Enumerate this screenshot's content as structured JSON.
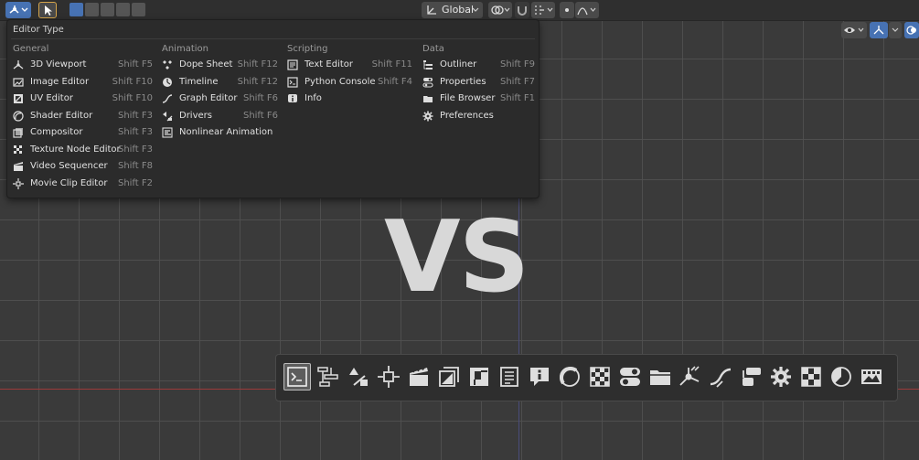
{
  "header": {
    "orientation_label": "Global"
  },
  "menu": {
    "title": "Editor Type",
    "columns": [
      {
        "heading": "General",
        "items": [
          {
            "label": "3D Viewport",
            "shortcut": "Shift F5",
            "icon": "viewport-3d-icon"
          },
          {
            "label": "Image Editor",
            "shortcut": "Shift F10",
            "icon": "image-editor-icon"
          },
          {
            "label": "UV Editor",
            "shortcut": "Shift F10",
            "icon": "uv-editor-icon"
          },
          {
            "label": "Shader Editor",
            "shortcut": "Shift F3",
            "icon": "shader-editor-icon"
          },
          {
            "label": "Compositor",
            "shortcut": "Shift F3",
            "icon": "compositor-icon"
          },
          {
            "label": "Texture Node Editor",
            "shortcut": "Shift F3",
            "icon": "texture-node-icon"
          },
          {
            "label": "Video Sequencer",
            "shortcut": "Shift F8",
            "icon": "video-sequencer-icon"
          },
          {
            "label": "Movie Clip Editor",
            "shortcut": "Shift F2",
            "icon": "movie-clip-icon"
          }
        ]
      },
      {
        "heading": "Animation",
        "items": [
          {
            "label": "Dope Sheet",
            "shortcut": "Shift F12",
            "icon": "dope-sheet-icon"
          },
          {
            "label": "Timeline",
            "shortcut": "Shift F12",
            "icon": "timeline-icon"
          },
          {
            "label": "Graph Editor",
            "shortcut": "Shift F6",
            "icon": "graph-editor-icon"
          },
          {
            "label": "Drivers",
            "shortcut": "Shift F6",
            "icon": "drivers-icon"
          },
          {
            "label": "Nonlinear Animation",
            "shortcut": "",
            "icon": "nla-icon"
          }
        ]
      },
      {
        "heading": "Scripting",
        "items": [
          {
            "label": "Text Editor",
            "shortcut": "Shift F11",
            "icon": "text-editor-icon"
          },
          {
            "label": "Python Console",
            "shortcut": "Shift F4",
            "icon": "python-console-icon"
          },
          {
            "label": "Info",
            "shortcut": "",
            "icon": "info-icon"
          }
        ]
      },
      {
        "heading": "Data",
        "items": [
          {
            "label": "Outliner",
            "shortcut": "Shift F9",
            "icon": "outliner-icon"
          },
          {
            "label": "Properties",
            "shortcut": "Shift F7",
            "icon": "properties-icon"
          },
          {
            "label": "File Browser",
            "shortcut": "Shift F1",
            "icon": "file-browser-icon"
          },
          {
            "label": "Preferences",
            "shortcut": "",
            "icon": "preferences-icon"
          }
        ]
      }
    ]
  },
  "overlay": {
    "vs_text": "VS"
  },
  "icon_bar": [
    "python-console-icon",
    "nla-icon",
    "drivers-icon",
    "movie-clip-icon",
    "video-sequencer-icon",
    "compositor-icon",
    "uv-editor-icon",
    "text-editor-icon",
    "info-icon",
    "shader-editor-icon",
    "texture-node-icon",
    "properties-icon",
    "file-browser-icon",
    "viewport-3d-icon",
    "graph-editor-icon",
    "outliner-icon",
    "preferences-icon",
    "texture-checker-icon",
    "timeline-icon",
    "image-editor-icon"
  ],
  "colors": {
    "accent_blue": "#4772b3",
    "menu_bg": "#2b2b2b",
    "viewport_bg": "#3a3a3a",
    "axis_x": "#9a3a3a",
    "axis_y": "#4a4c7a"
  }
}
